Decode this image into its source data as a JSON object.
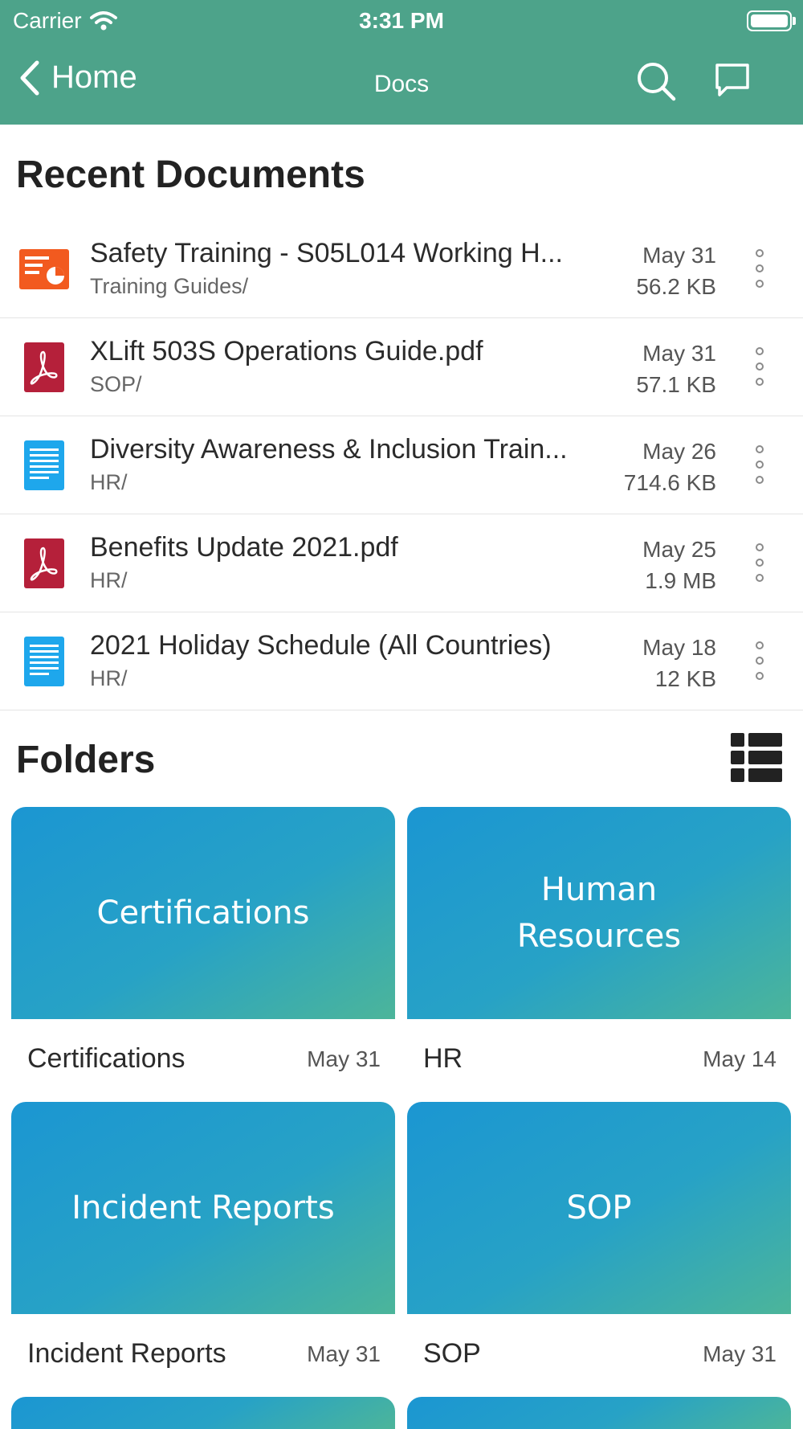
{
  "status_bar": {
    "carrier": "Carrier",
    "time": "3:31 PM"
  },
  "nav": {
    "back_label": "Home",
    "title": "Docs"
  },
  "recent": {
    "title": "Recent Documents",
    "items": [
      {
        "name": "Safety Training - S05L014 Working H...",
        "path": "Training Guides/",
        "date": "May 31",
        "size": "56.2 KB",
        "icon": "presentation-icon"
      },
      {
        "name": "XLift 503S Operations Guide.pdf",
        "path": "SOP/",
        "date": "May 31",
        "size": "57.1 KB",
        "icon": "pdf-icon"
      },
      {
        "name": "Diversity Awareness & Inclusion Train...",
        "path": "HR/",
        "date": "May 26",
        "size": "714.6 KB",
        "icon": "document-icon"
      },
      {
        "name": "Benefits Update 2021.pdf",
        "path": "HR/",
        "date": "May 25",
        "size": "1.9 MB",
        "icon": "pdf-icon"
      },
      {
        "name": "2021 Holiday Schedule (All Countries)",
        "path": "HR/",
        "date": "May 18",
        "size": "12 KB",
        "icon": "document-icon"
      }
    ]
  },
  "folders": {
    "title": "Folders",
    "items": [
      {
        "tile_text": "Certifications",
        "label": "Certifications",
        "date": "May 31"
      },
      {
        "tile_text": "Human Resources",
        "label": "HR",
        "date": "May 14"
      },
      {
        "tile_text": "Incident Reports",
        "label": "Incident Reports",
        "date": "May 31"
      },
      {
        "tile_text": "SOP",
        "label": "SOP",
        "date": "May 31"
      }
    ]
  },
  "colors": {
    "header": "#4da38a",
    "presentation_icon": "#f25a1f",
    "pdf_icon": "#b5203a",
    "document_icon": "#1ea7ec",
    "tile_gradient_start": "#1b96d2",
    "tile_gradient_end": "#4cb59a"
  }
}
